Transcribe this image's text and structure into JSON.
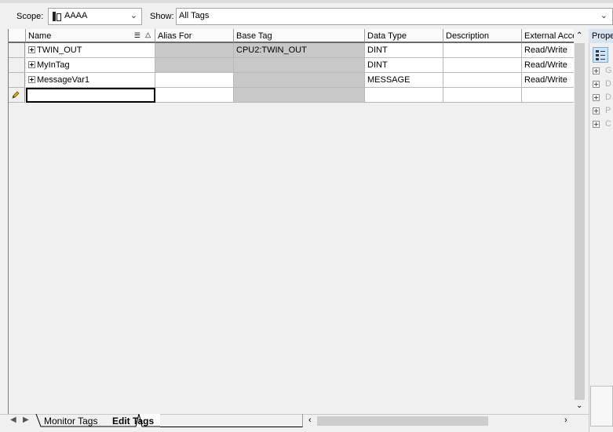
{
  "toolbar": {
    "scope_label": "Scope:",
    "scope_value": "AAAA",
    "show_label": "Show:",
    "show_value": "All Tags"
  },
  "grid": {
    "columns": {
      "name": "Name",
      "alias_for": "Alias For",
      "base_tag": "Base Tag",
      "data_type": "Data Type",
      "description": "Description",
      "external_access": "External Acce"
    },
    "rows": [
      {
        "name": "TWIN_OUT",
        "alias_for": "",
        "base_tag": "CPU2:TWIN_OUT",
        "data_type": "DINT",
        "description": "",
        "external_access": "Read/Write"
      },
      {
        "name": "MyInTag",
        "alias_for": "",
        "base_tag": "",
        "data_type": "DINT",
        "description": "",
        "external_access": "Read/Write"
      },
      {
        "name": "MessageVar1",
        "alias_for": "",
        "base_tag": "",
        "data_type": "MESSAGE",
        "description": "",
        "external_access": "Read/Write"
      }
    ]
  },
  "properties": {
    "title": "Prope",
    "items": [
      "G",
      "D",
      "D",
      "P",
      "C"
    ]
  },
  "tabs": {
    "monitor": "Monitor Tags",
    "edit": "Edit Tags"
  },
  "colors": {
    "readonly_cell": "#c8c8c8",
    "edit_pencil": "#e0b000"
  }
}
